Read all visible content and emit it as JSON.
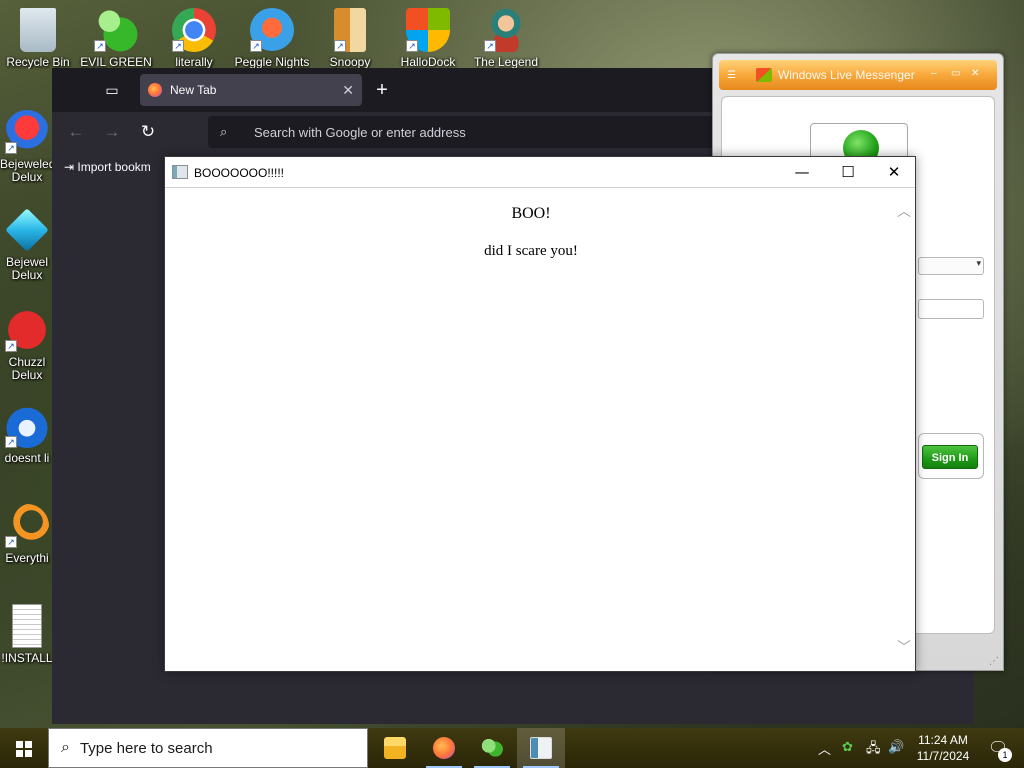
{
  "desktop": {
    "top_icons": [
      {
        "label": "Recycle Bin"
      },
      {
        "label": "EVIL GREEN"
      },
      {
        "label": "literally"
      },
      {
        "label": "Peggle Nights"
      },
      {
        "label": "Snoopy"
      },
      {
        "label": "HalloDock"
      },
      {
        "label": "The Legend"
      }
    ],
    "left_icons": [
      {
        "label": "Bejeweled Delux"
      },
      {
        "label": "Bejewel Delux"
      },
      {
        "label": "Chuzzl Delux"
      },
      {
        "label": "doesnt li"
      },
      {
        "label": "Everythi"
      },
      {
        "label": "!INSTALL"
      }
    ]
  },
  "firefox": {
    "tab_title": "New Tab",
    "url_placeholder": "Search with Google or enter address",
    "import_bookmarks": "Import bookm"
  },
  "messenger": {
    "title": "Windows Live Messenger",
    "signin_label": "Sign In"
  },
  "boo_window": {
    "title": "BOOOOOOO!!!!!",
    "heading": "BOO!",
    "message": "did I scare you!"
  },
  "taskbar": {
    "search_placeholder": "Type here to search",
    "time": "11:24 AM",
    "date": "11/7/2024",
    "notification_count": "1"
  },
  "colors": {
    "firefox_bg": "#1c1b22",
    "firefox_toolbar": "#2b2a33",
    "messenger_orange": "#f8a83b",
    "signin_green": "#1f9a16",
    "taskbar_bg": "#3a3611"
  }
}
